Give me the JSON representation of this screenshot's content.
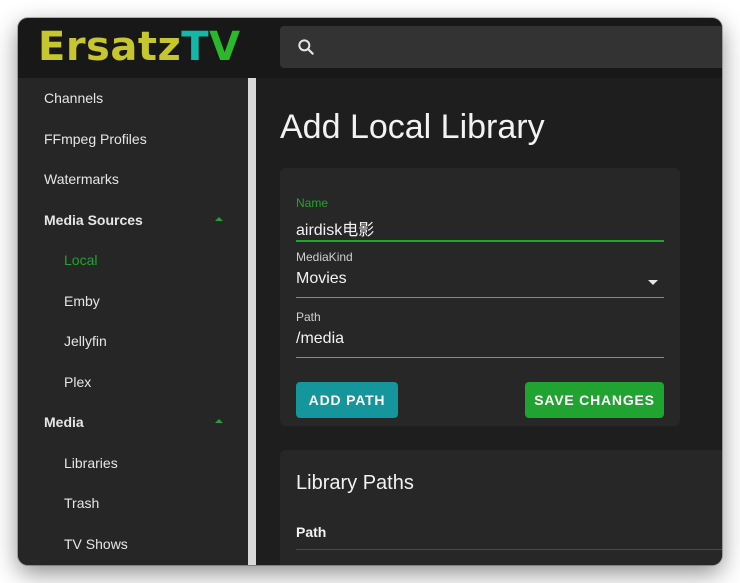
{
  "app": {
    "logo": {
      "part1": "Ersatz",
      "part2": "T",
      "part3": "V"
    },
    "search": {
      "icon": "search-icon",
      "value": ""
    }
  },
  "sidebar": {
    "items": [
      {
        "label": "Channels"
      },
      {
        "label": "FFmpeg Profiles"
      },
      {
        "label": "Watermarks"
      },
      {
        "label": "Media Sources",
        "expanded": true
      },
      {
        "label": "Local",
        "active": true
      },
      {
        "label": "Emby"
      },
      {
        "label": "Jellyfin"
      },
      {
        "label": "Plex"
      },
      {
        "label": "Media",
        "expanded": true
      },
      {
        "label": "Libraries"
      },
      {
        "label": "Trash"
      },
      {
        "label": "TV Shows"
      }
    ]
  },
  "main": {
    "title": "Add Local Library",
    "form": {
      "name": {
        "label": "Name",
        "value": "airdisk电影"
      },
      "media_kind": {
        "label": "MediaKind",
        "value": "Movies"
      },
      "path": {
        "label": "Path",
        "value": "/media"
      },
      "add_path_label": "ADD PATH",
      "save_label": "SAVE CHANGES"
    },
    "paths_card": {
      "title": "Library Paths",
      "column": "Path"
    }
  },
  "colors": {
    "accent_green": "#21a331",
    "accent_teal": "#14969c",
    "logo_yellow": "#c6c62e",
    "logo_teal": "#14b8a6"
  }
}
